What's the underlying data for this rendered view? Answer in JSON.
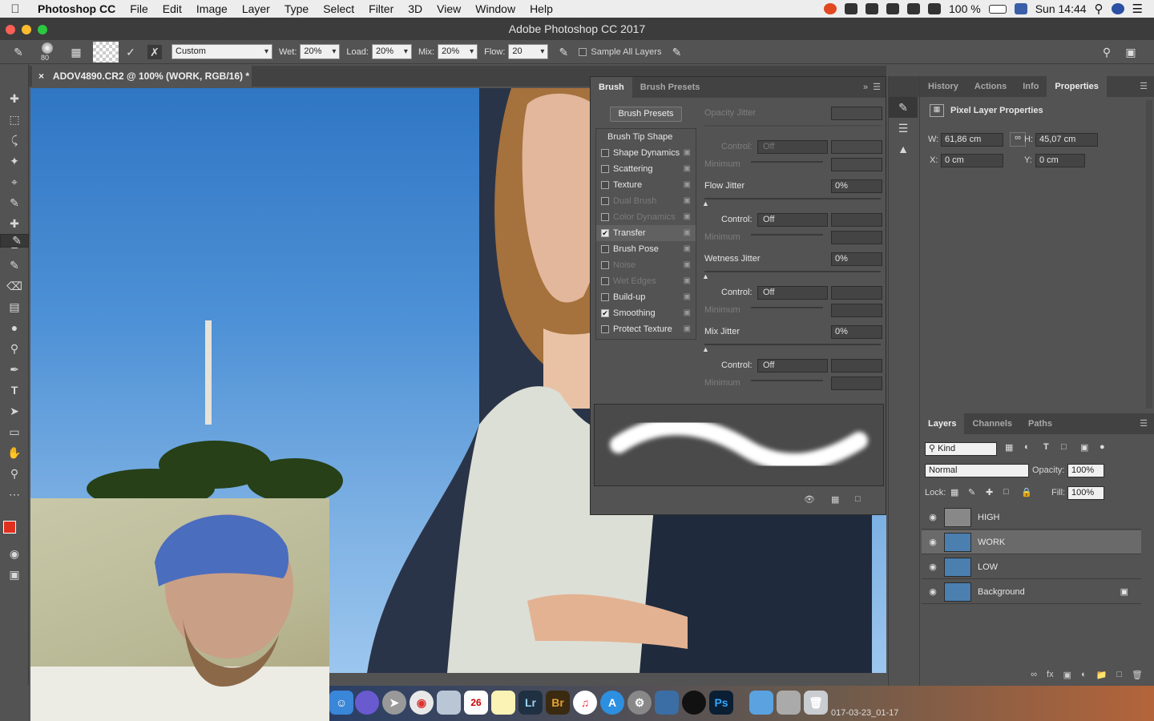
{
  "menubar": {
    "apple": "",
    "app": "Photoshop CC",
    "items": [
      "File",
      "Edit",
      "Image",
      "Layer",
      "Type",
      "Select",
      "Filter",
      "3D",
      "View",
      "Window",
      "Help"
    ],
    "battery": "100 %",
    "clock": "Sun 14:44"
  },
  "window": {
    "title": "Adobe Photoshop CC 2017"
  },
  "options": {
    "size": "80",
    "preset": "Custom",
    "wet_label": "Wet:",
    "wet": "20%",
    "load_label": "Load:",
    "load": "20%",
    "mix_label": "Mix:",
    "mix": "20%",
    "flow_label": "Flow:",
    "flow": "20",
    "sample_all": "Sample All Layers"
  },
  "document": {
    "close": "×",
    "tab": "ADOV4890.CR2 @ 100% (WORK, RGB/16) *"
  },
  "brush_panel": {
    "tabs": [
      "Brush",
      "Brush Presets"
    ],
    "presets_button": "Brush Presets",
    "items": [
      {
        "label": "Brush Tip Shape",
        "check": "",
        "state": "header"
      },
      {
        "label": "Shape Dynamics",
        "check": "",
        "state": "normal"
      },
      {
        "label": "Scattering",
        "check": "",
        "state": "normal"
      },
      {
        "label": "Texture",
        "check": "",
        "state": "normal"
      },
      {
        "label": "Dual Brush",
        "check": "",
        "state": "dis"
      },
      {
        "label": "Color Dynamics",
        "check": "",
        "state": "dis"
      },
      {
        "label": "Transfer",
        "check": "✔",
        "state": "hl"
      },
      {
        "label": "Brush Pose",
        "check": "",
        "state": "normal"
      },
      {
        "label": "Noise",
        "check": "",
        "state": "dis"
      },
      {
        "label": "Wet Edges",
        "check": "",
        "state": "dis"
      },
      {
        "label": "Build-up",
        "check": "",
        "state": "normal"
      },
      {
        "label": "Smoothing",
        "check": "✔",
        "state": "normal"
      },
      {
        "label": "Protect Texture",
        "check": "",
        "state": "normal"
      }
    ],
    "opacity_jitter": "Opacity Jitter",
    "control_label": "Control:",
    "minimum_label": "Minimum",
    "off": "Off",
    "flow_jitter": "Flow Jitter",
    "flow_jitter_val": "0%",
    "wetness_jitter": "Wetness Jitter",
    "wetness_jitter_val": "0%",
    "mix_jitter": "Mix Jitter",
    "mix_jitter_val": "0%"
  },
  "right_tabs": [
    "History",
    "Actions",
    "Info",
    "Properties"
  ],
  "properties": {
    "title": "Pixel Layer Properties",
    "w_label": "W:",
    "w": "61,86 cm",
    "h_label": "H:",
    "h": "45,07 cm",
    "x_label": "X:",
    "x": "0 cm",
    "y_label": "Y:",
    "y": "0 cm"
  },
  "layers_panel": {
    "tabs": [
      "Layers",
      "Channels",
      "Paths"
    ],
    "kind": "Kind",
    "blend": "Normal",
    "opacity_label": "Opacity:",
    "opacity": "100%",
    "lock_label": "Lock:",
    "fill_label": "Fill:",
    "fill": "100%",
    "layers": [
      {
        "name": "HIGH",
        "active": false,
        "locked": false,
        "thumb": "#888"
      },
      {
        "name": "WORK",
        "active": true,
        "locked": false,
        "thumb": "#4a7fb0"
      },
      {
        "name": "LOW",
        "active": false,
        "locked": false,
        "thumb": "#4a7fb0"
      },
      {
        "name": "Background",
        "active": false,
        "locked": true,
        "thumb": "#4a7fb0"
      }
    ]
  },
  "dock": {
    "lr": "Lr",
    "br": "Br",
    "ps": "Ps",
    "cal": "26",
    "desktop_text": "017-03-23_01-17"
  }
}
